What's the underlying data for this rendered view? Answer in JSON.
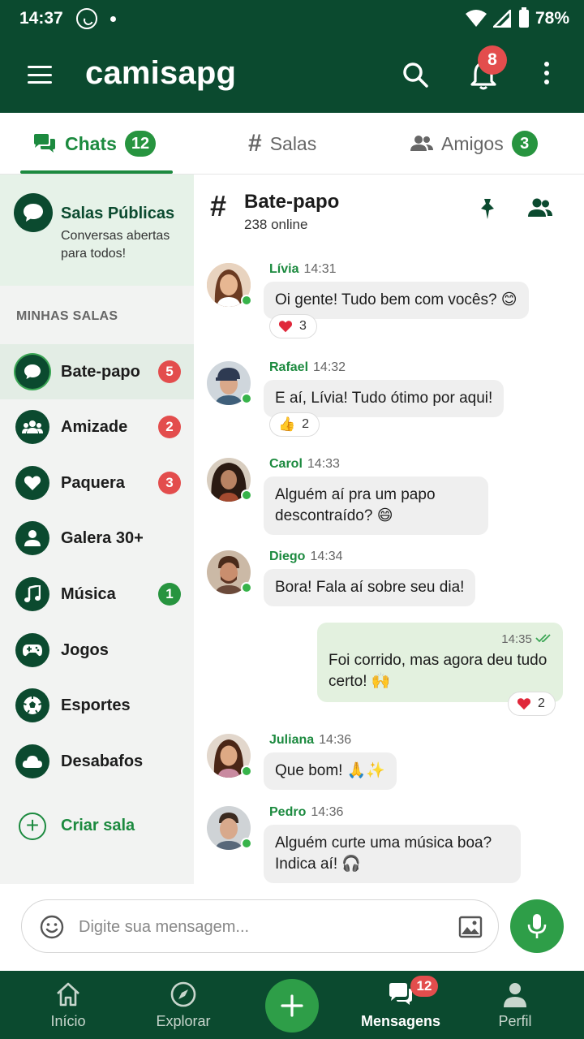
{
  "status": {
    "time": "14:37",
    "battery": "78%"
  },
  "appbar": {
    "title": "camisapg",
    "notification_count": "8"
  },
  "tabs": [
    {
      "label": "Chats",
      "badge": "12"
    },
    {
      "label": "Salas"
    },
    {
      "label": "Amigos",
      "badge": "3"
    }
  ],
  "sidebar": {
    "public": {
      "title": "Salas Públicas",
      "subtitle": "Conversas abertas para todos!"
    },
    "section_label": "MINHAS SALAS",
    "rooms": [
      {
        "label": "Bate-papo",
        "badge": "5",
        "icon": "chat-icon"
      },
      {
        "label": "Amizade",
        "badge": "2",
        "icon": "group-icon"
      },
      {
        "label": "Paquera",
        "badge": "3",
        "icon": "heart-icon"
      },
      {
        "label": "Galera 30+",
        "icon": "person-icon"
      },
      {
        "label": "Música",
        "badge": "1",
        "icon": "music-icon"
      },
      {
        "label": "Jogos",
        "icon": "gamepad-icon"
      },
      {
        "label": "Esportes",
        "icon": "soccer-ball-icon"
      },
      {
        "label": "Desabafos",
        "icon": "cloud-icon"
      }
    ],
    "create_label": "Criar sala"
  },
  "chat": {
    "title": "Bate-papo",
    "online": "238 online",
    "messages": [
      {
        "name": "Lívia",
        "time": "14:31",
        "text": "Oi gente! Tudo bem com vocês? 😊",
        "reaction": "3"
      },
      {
        "name": "Rafael",
        "time": "14:32",
        "text": "E aí, Lívia! Tudo ótimo por aqui!",
        "reaction": "2"
      },
      {
        "name": "Carol",
        "time": "14:33",
        "text": "Alguém aí pra um papo descontraído? 😄"
      },
      {
        "name": "Diego",
        "time": "14:34",
        "text": "Bora! Fala aí sobre seu dia!"
      },
      {
        "name": "Juliana",
        "time": "14:36",
        "text": "Que bom! 🙏✨"
      },
      {
        "name": "Pedro",
        "time": "14:36",
        "text": "Alguém curte uma música boa? Indica aí! 🎧"
      }
    ],
    "own_message": {
      "time": "14:35",
      "text": "Foi corrido, mas agora deu tudo certo! 🙌",
      "reaction": "2"
    }
  },
  "composer": {
    "placeholder": "Digite sua mensagem..."
  },
  "bottomnav": {
    "items": [
      {
        "label": "Início"
      },
      {
        "label": "Explorar"
      },
      {
        "label": "Mensagens",
        "badge": "12"
      },
      {
        "label": "Perfil"
      }
    ]
  },
  "colors": {
    "primary_dark": "#0b4a2f",
    "accent": "#1c8a3f",
    "badge_red": "#e34d4d",
    "own_bubble": "#e3f1df"
  }
}
